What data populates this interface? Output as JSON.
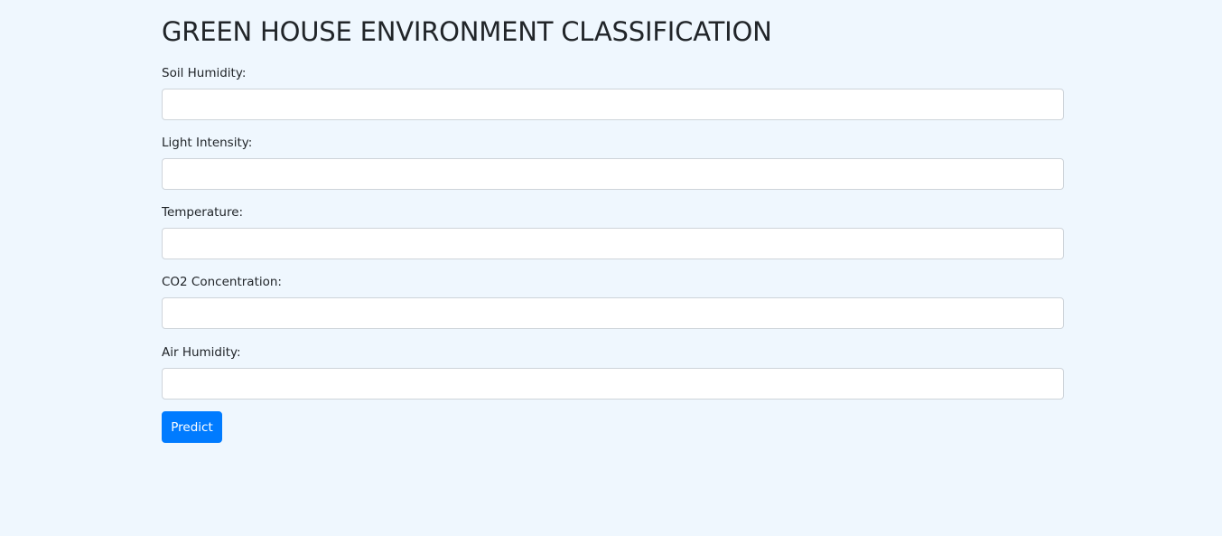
{
  "page": {
    "title": "GREEN HOUSE ENVIRONMENT CLASSIFICATION"
  },
  "form": {
    "fields": [
      {
        "label": "Soil Humidity:",
        "value": "",
        "placeholder": ""
      },
      {
        "label": "Light Intensity:",
        "value": "",
        "placeholder": ""
      },
      {
        "label": "Temperature:",
        "value": "",
        "placeholder": ""
      },
      {
        "label": "CO2 Concentration:",
        "value": "",
        "placeholder": ""
      },
      {
        "label": "Air Humidity:",
        "value": "",
        "placeholder": ""
      }
    ],
    "submit_label": "Predict"
  },
  "colors": {
    "background": "#eff7fe",
    "primary": "#007bff",
    "input_border": "#ced4da"
  }
}
